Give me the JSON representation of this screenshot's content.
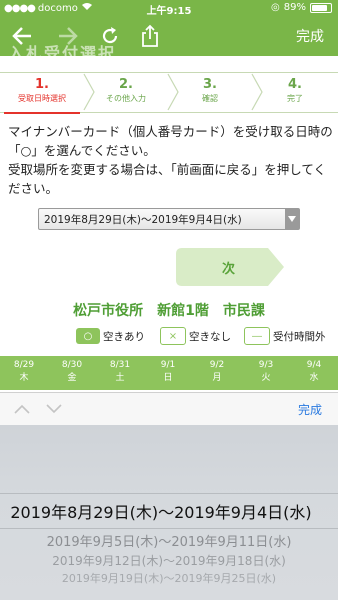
{
  "status": {
    "carrier": "docomo",
    "time": "上午9:15",
    "battery": "89%"
  },
  "nav": {
    "done_label": "完成",
    "ghost_title": "入札受付選択"
  },
  "steps": [
    {
      "num": "1.",
      "label": "受取日時選択"
    },
    {
      "num": "2.",
      "label": "その他入力"
    },
    {
      "num": "3.",
      "label": "確認"
    },
    {
      "num": "4.",
      "label": "完了"
    }
  ],
  "instructions": {
    "line1": "マイナンバーカード（個人番号カード）を受け取る日時の「○」を選んでください。",
    "line2": "受取場所を変更する場合は、「前画面に戻る」を押してください。"
  },
  "date_select": {
    "value": "2019年8月29日(木)～2019年9月4日(水)"
  },
  "next_button": {
    "label": "次"
  },
  "location": {
    "title": "松戸市役所　新館1階　市民課"
  },
  "legend": {
    "available_symbol": "○",
    "available_label": "空きあり",
    "full_symbol": "×",
    "full_label": "空きなし",
    "closed_symbol": "―",
    "closed_label": "受付時間外"
  },
  "days": [
    {
      "date": "8/29",
      "dow": "木"
    },
    {
      "date": "8/30",
      "dow": "金"
    },
    {
      "date": "8/31",
      "dow": "土"
    },
    {
      "date": "9/1",
      "dow": "日"
    },
    {
      "date": "9/2",
      "dow": "月"
    },
    {
      "date": "9/3",
      "dow": "火"
    },
    {
      "date": "9/4",
      "dow": "水"
    }
  ],
  "picker": {
    "done_label": "完成",
    "options": [
      "2019年8月29日(木)～2019年9月4日(水)",
      "2019年9月5日(木)～2019年9月11日(水)",
      "2019年9月12日(木)～2019年9月18日(水)",
      "2019年9月19日(木)～2019年9月25日(水)"
    ]
  },
  "colors": {
    "brand_green": "#7ab648",
    "active_red": "#e4322b",
    "link_blue": "#2a7ae0"
  }
}
